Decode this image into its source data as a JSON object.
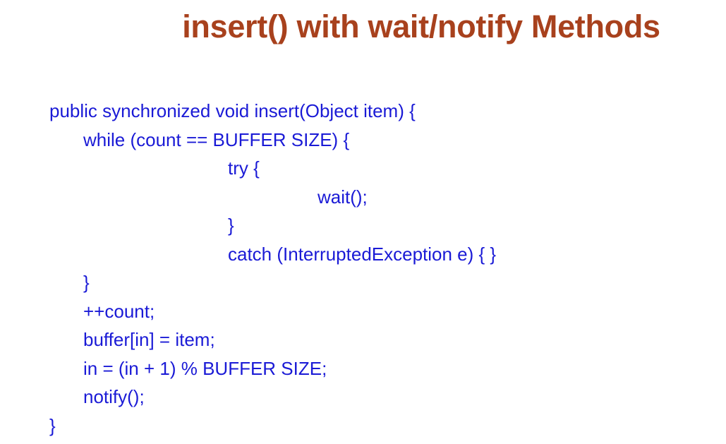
{
  "slide": {
    "title": "insert() with wait/notify Methods",
    "title_color": "#a8411d",
    "code_color": "#1a1ad6",
    "code_lines": [
      "public synchronized void insert(Object item) {",
      "while (count == BUFFER SIZE) {",
      "try {",
      "wait();",
      "}",
      "catch (InterruptedException e) { }",
      "}",
      "++count;",
      "buffer[in] = item;",
      "in = (in + 1) % BUFFER SIZE;",
      "notify();",
      "}"
    ]
  }
}
